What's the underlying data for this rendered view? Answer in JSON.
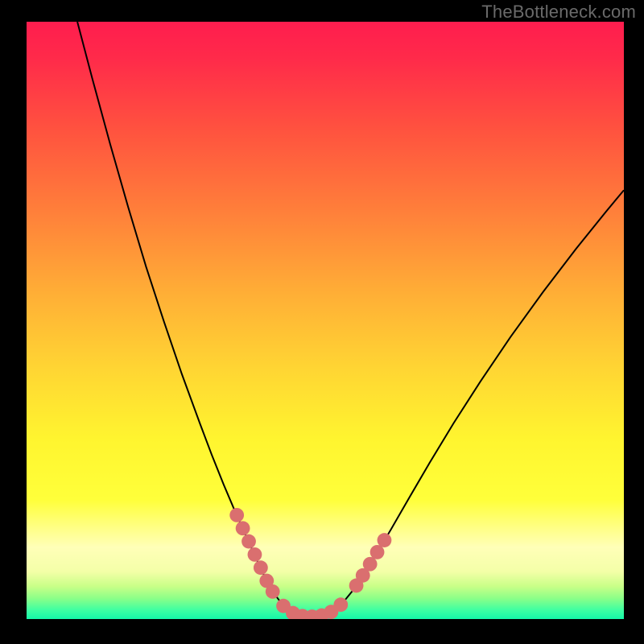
{
  "watermark": "TheBottleneck.com",
  "chart_data": {
    "type": "line",
    "title": "",
    "xlabel": "",
    "ylabel": "",
    "xlim": [
      0,
      1
    ],
    "ylim": [
      0,
      1
    ],
    "grid": false,
    "legend": false,
    "background": {
      "type": "vertical-gradient",
      "stops": [
        {
          "t": 0.0,
          "color": "#ff1d4e"
        },
        {
          "t": 0.06,
          "color": "#ff2a4a"
        },
        {
          "t": 0.18,
          "color": "#ff523f"
        },
        {
          "t": 0.32,
          "color": "#ff803a"
        },
        {
          "t": 0.46,
          "color": "#ffb036"
        },
        {
          "t": 0.58,
          "color": "#ffd533"
        },
        {
          "t": 0.7,
          "color": "#fff52f"
        },
        {
          "t": 0.8,
          "color": "#ffff3a"
        },
        {
          "t": 0.84,
          "color": "#ffff7a"
        },
        {
          "t": 0.88,
          "color": "#ffffb8"
        },
        {
          "t": 0.92,
          "color": "#f4ffa8"
        },
        {
          "t": 0.945,
          "color": "#c9ff88"
        },
        {
          "t": 0.965,
          "color": "#8dff88"
        },
        {
          "t": 0.985,
          "color": "#3effa2"
        },
        {
          "t": 1.0,
          "color": "#14f7a8"
        }
      ]
    },
    "series": [
      {
        "name": "curve",
        "color": "#000000",
        "stroke_width": 2,
        "points": [
          {
            "x": 0.085,
            "y": 1.0
          },
          {
            "x": 0.11,
            "y": 0.905
          },
          {
            "x": 0.14,
            "y": 0.795
          },
          {
            "x": 0.17,
            "y": 0.69
          },
          {
            "x": 0.2,
            "y": 0.59
          },
          {
            "x": 0.23,
            "y": 0.498
          },
          {
            "x": 0.26,
            "y": 0.41
          },
          {
            "x": 0.29,
            "y": 0.328
          },
          {
            "x": 0.31,
            "y": 0.275
          },
          {
            "x": 0.33,
            "y": 0.225
          },
          {
            "x": 0.35,
            "y": 0.178
          },
          {
            "x": 0.368,
            "y": 0.138
          },
          {
            "x": 0.385,
            "y": 0.1
          },
          {
            "x": 0.4,
            "y": 0.068
          },
          {
            "x": 0.415,
            "y": 0.042
          },
          {
            "x": 0.43,
            "y": 0.022
          },
          {
            "x": 0.445,
            "y": 0.01
          },
          {
            "x": 0.462,
            "y": 0.004
          },
          {
            "x": 0.48,
            "y": 0.003
          },
          {
            "x": 0.498,
            "y": 0.006
          },
          {
            "x": 0.515,
            "y": 0.014
          },
          {
            "x": 0.53,
            "y": 0.028
          },
          {
            "x": 0.548,
            "y": 0.05
          },
          {
            "x": 0.565,
            "y": 0.076
          },
          {
            "x": 0.585,
            "y": 0.108
          },
          {
            "x": 0.61,
            "y": 0.15
          },
          {
            "x": 0.64,
            "y": 0.202
          },
          {
            "x": 0.675,
            "y": 0.262
          },
          {
            "x": 0.715,
            "y": 0.328
          },
          {
            "x": 0.76,
            "y": 0.398
          },
          {
            "x": 0.81,
            "y": 0.472
          },
          {
            "x": 0.865,
            "y": 0.548
          },
          {
            "x": 0.92,
            "y": 0.62
          },
          {
            "x": 0.97,
            "y": 0.682
          },
          {
            "x": 1.0,
            "y": 0.718
          }
        ]
      }
    ],
    "markers": [
      {
        "name": "left-dots",
        "color": "#da6f6f",
        "radius_norm": 0.012,
        "points": [
          {
            "x": 0.352,
            "y": 0.174
          },
          {
            "x": 0.362,
            "y": 0.152
          },
          {
            "x": 0.372,
            "y": 0.13
          },
          {
            "x": 0.382,
            "y": 0.108
          },
          {
            "x": 0.392,
            "y": 0.086
          },
          {
            "x": 0.402,
            "y": 0.064
          },
          {
            "x": 0.412,
            "y": 0.046
          }
        ]
      },
      {
        "name": "bottom-dots",
        "color": "#da6f6f",
        "radius_norm": 0.012,
        "points": [
          {
            "x": 0.43,
            "y": 0.022
          },
          {
            "x": 0.446,
            "y": 0.01
          },
          {
            "x": 0.462,
            "y": 0.005
          },
          {
            "x": 0.478,
            "y": 0.004
          },
          {
            "x": 0.494,
            "y": 0.006
          },
          {
            "x": 0.51,
            "y": 0.012
          },
          {
            "x": 0.526,
            "y": 0.024
          }
        ]
      },
      {
        "name": "right-dots",
        "color": "#da6f6f",
        "radius_norm": 0.012,
        "points": [
          {
            "x": 0.552,
            "y": 0.056
          },
          {
            "x": 0.563,
            "y": 0.073
          },
          {
            "x": 0.575,
            "y": 0.092
          },
          {
            "x": 0.587,
            "y": 0.112
          },
          {
            "x": 0.599,
            "y": 0.132
          }
        ]
      }
    ]
  }
}
